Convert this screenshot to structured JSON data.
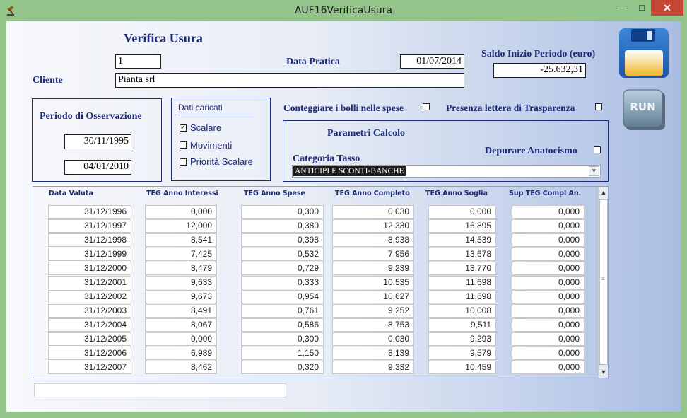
{
  "window": {
    "title": "AUF16VerificaUsura",
    "minimize": "–",
    "maximize": "□",
    "close": "✕"
  },
  "form": {
    "heading": "Verifica Usura",
    "id_value": "1",
    "cliente_label": "Cliente",
    "cliente_value": "Pianta srl",
    "data_pratica_label": "Data Pratica",
    "data_pratica_value": "01/07/2014",
    "saldo_label": "Saldo Inizio Periodo (euro)",
    "saldo_value": "-25.632,31"
  },
  "periodo": {
    "label": "Periodo di Osservazione",
    "start": "30/11/1995",
    "end": "04/01/2010"
  },
  "dati_caricati": {
    "label": "Dati caricati",
    "options": [
      {
        "label": "Scalare",
        "checked": true
      },
      {
        "label": "Movimenti",
        "checked": false
      },
      {
        "label": "Priorità Scalare",
        "checked": false
      }
    ]
  },
  "options": {
    "bolli_label": "Conteggiare i bolli nelle spese",
    "trasparenza_label": "Presenza lettera di Trasparenza"
  },
  "parametri": {
    "label": "Parametri Calcolo",
    "depurare_label": "Depurare Anatocismo",
    "categoria_label": "Categoria Tasso",
    "categoria_value": "ANTICIPI E SCONTI-BANCHE"
  },
  "toolbar": {
    "save_icon": "floppy-disk-icon",
    "run_label": "RUN"
  },
  "table": {
    "columns": [
      "Data Valuta",
      "TEG Anno Interessi",
      "TEG Anno Spese",
      "TEG Anno Completo",
      "TEG Anno Soglia",
      "Sup TEG Compl An."
    ],
    "rows": [
      [
        "31/12/1996",
        "0,000",
        "0,300",
        "0,030",
        "0,000",
        "0,000"
      ],
      [
        "31/12/1997",
        "12,000",
        "0,380",
        "12,330",
        "16,895",
        "0,000"
      ],
      [
        "31/12/1998",
        "8,541",
        "0,398",
        "8,938",
        "14,539",
        "0,000"
      ],
      [
        "31/12/1999",
        "7,425",
        "0,532",
        "7,956",
        "13,678",
        "0,000"
      ],
      [
        "31/12/2000",
        "8,479",
        "0,729",
        "9,239",
        "13,770",
        "0,000"
      ],
      [
        "31/12/2001",
        "9,633",
        "0,333",
        "10,535",
        "11,698",
        "0,000"
      ],
      [
        "31/12/2002",
        "9,673",
        "0,954",
        "10,627",
        "11,698",
        "0,000"
      ],
      [
        "31/12/2003",
        "8,491",
        "0,761",
        "9,252",
        "10,008",
        "0,000"
      ],
      [
        "31/12/2004",
        "8,067",
        "0,586",
        "8,753",
        "9,511",
        "0,000"
      ],
      [
        "31/12/2005",
        "0,000",
        "0,300",
        "0,030",
        "9,293",
        "0,000"
      ],
      [
        "31/12/2006",
        "6,989",
        "1,150",
        "8,139",
        "9,579",
        "0,000"
      ],
      [
        "31/12/2007",
        "8,462",
        "0,320",
        "9,332",
        "10,459",
        "0,000"
      ]
    ]
  },
  "colors": {
    "frame": "#93c48a",
    "label_blue": "#1d2a78",
    "close_red": "#c64535"
  }
}
